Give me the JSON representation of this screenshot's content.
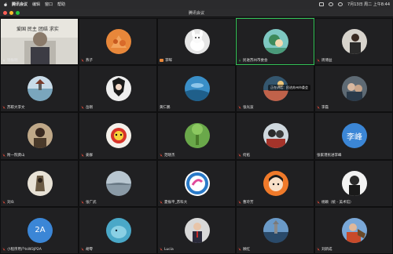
{
  "menubar": {
    "app": "腾讯会议",
    "items": [
      "编辑",
      "窗口",
      "帮助"
    ],
    "time": "7月13日 周二 上午8:44"
  },
  "window": {
    "title": "腾讯会议"
  },
  "video_banner": "爱国 民主 团结 求实",
  "participants": [
    {
      "name": "钱振明",
      "mic": "on"
    },
    {
      "name": "燕子",
      "mic": "muted"
    },
    {
      "name": "李晖",
      "mic": "muted"
    },
    {
      "name": "民进苏州市委会",
      "mic": "on"
    },
    {
      "name": "周博益",
      "mic": "muted"
    },
    {
      "name": "苏职大李文",
      "mic": "muted"
    },
    {
      "name": "岳刚",
      "mic": "muted"
    },
    {
      "name": "黄仁鹏",
      "mic": "muted"
    },
    {
      "name": "张光波",
      "mic": "muted"
    },
    {
      "name": "李磊",
      "mic": "muted"
    },
    {
      "name": "附一院龚山",
      "mic": "muted"
    },
    {
      "name": "姜群",
      "mic": "muted"
    },
    {
      "name": "范晓杰",
      "mic": "muted"
    },
    {
      "name": "何拓",
      "mic": "muted"
    },
    {
      "name": "张家港民进李峰",
      "mic": "muted"
    },
    {
      "name": "刘众",
      "mic": "muted"
    },
    {
      "name": "张广武",
      "mic": "muted"
    },
    {
      "name": "夏振平_苏科大",
      "mic": "muted"
    },
    {
      "name": "曹玲芳",
      "mic": "muted"
    },
    {
      "name": "杨颖（统 - 美术馆）",
      "mic": "muted"
    },
    {
      "name": "小程序用户tsW3jP2A",
      "mic": "muted"
    },
    {
      "name": "胡零",
      "mic": "muted"
    },
    {
      "name": "Lucia",
      "mic": "muted"
    },
    {
      "name": "顾红",
      "mic": "muted"
    },
    {
      "name": "刘新成",
      "mic": "muted"
    }
  ],
  "speaking_caption": "正在讲话：民进苏州市委会",
  "text_avatars": {
    "li_feng": "李峰",
    "user_2a": "2A"
  },
  "colors": {
    "grid_bg": "#161618",
    "tile_bg": "#202022",
    "active_border": "#34c759",
    "mute_red": "#e04a3a"
  }
}
